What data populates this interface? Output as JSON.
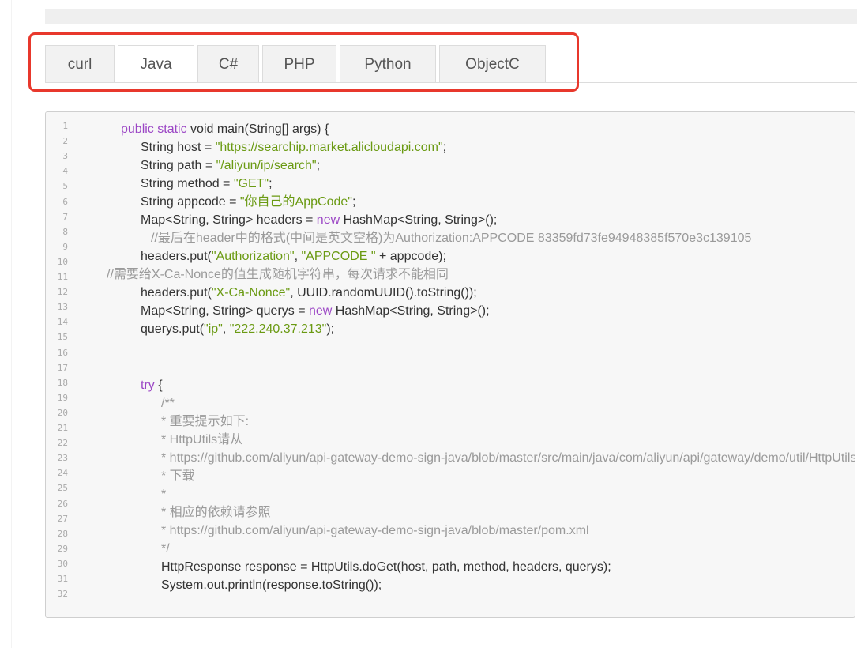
{
  "tabs": [
    {
      "label": "curl",
      "active": false
    },
    {
      "label": "Java",
      "active": true
    },
    {
      "label": "C#",
      "active": false
    },
    {
      "label": "PHP",
      "active": false
    },
    {
      "label": "Python",
      "active": false
    },
    {
      "label": "ObjectC",
      "active": false
    }
  ],
  "line_numbers": [
    "1",
    "2",
    "3",
    "4",
    "5",
    "6",
    "7",
    "8",
    "9",
    "10",
    "11",
    "12",
    "13",
    "14",
    "15",
    "16",
    "17",
    "18",
    "19",
    "20",
    "21",
    "22",
    "23",
    "24",
    "25",
    "26",
    "27",
    "28",
    "29",
    "30",
    "31",
    "32"
  ],
  "code_lines": [
    [
      {
        "t": "public static ",
        "c": "k"
      },
      {
        "t": "void main(String[] args) {",
        "c": "p"
      }
    ],
    [
      {
        "t": "String host = ",
        "c": "p"
      },
      {
        "t": "\"https://searchip.market.alicloudapi.com\"",
        "c": "s"
      },
      {
        "t": ";",
        "c": "p"
      }
    ],
    [
      {
        "t": "String path = ",
        "c": "p"
      },
      {
        "t": "\"/aliyun/ip/search\"",
        "c": "s"
      },
      {
        "t": ";",
        "c": "p"
      }
    ],
    [
      {
        "t": "String method = ",
        "c": "p"
      },
      {
        "t": "\"GET\"",
        "c": "s"
      },
      {
        "t": ";",
        "c": "p"
      }
    ],
    [
      {
        "t": "String appcode = ",
        "c": "p"
      },
      {
        "t": "\"你自己的AppCode\"",
        "c": "s"
      },
      {
        "t": ";",
        "c": "p"
      }
    ],
    [
      {
        "t": "Map<String, String> headers = ",
        "c": "p"
      },
      {
        "t": "new ",
        "c": "k"
      },
      {
        "t": "HashMap<String, String>();",
        "c": "p"
      }
    ],
    [
      {
        "t": "//最后在header中的格式(中间是英文空格)为Authorization:APPCODE 83359fd73fe94948385f570e3c139105",
        "c": "c"
      }
    ],
    [
      {
        "t": "headers.put(",
        "c": "p"
      },
      {
        "t": "\"Authorization\"",
        "c": "s"
      },
      {
        "t": ", ",
        "c": "p"
      },
      {
        "t": "\"APPCODE \"",
        "c": "s"
      },
      {
        "t": " + appcode);",
        "c": "p"
      }
    ],
    [
      {
        "t": "//需要给X-Ca-Nonce的值生成随机字符串，每次请求不能相同",
        "c": "c"
      }
    ],
    [
      {
        "t": "headers.put(",
        "c": "p"
      },
      {
        "t": "\"X-Ca-Nonce\"",
        "c": "s"
      },
      {
        "t": ", UUID.randomUUID().toString());",
        "c": "p"
      }
    ],
    [
      {
        "t": "Map<String, String> querys = ",
        "c": "p"
      },
      {
        "t": "new ",
        "c": "k"
      },
      {
        "t": "HashMap<String, String>();",
        "c": "p"
      }
    ],
    [
      {
        "t": "querys.put(",
        "c": "p"
      },
      {
        "t": "\"ip\"",
        "c": "s"
      },
      {
        "t": ", ",
        "c": "p"
      },
      {
        "t": "\"222.240.37.213\"",
        "c": "s"
      },
      {
        "t": ");",
        "c": "p"
      }
    ],
    [],
    [],
    [
      {
        "t": "try ",
        "c": "k"
      },
      {
        "t": "{",
        "c": "p"
      }
    ],
    [
      {
        "t": "/**",
        "c": "c"
      }
    ],
    [
      {
        "t": "* 重要提示如下:",
        "c": "c"
      }
    ],
    [
      {
        "t": "* HttpUtils请从",
        "c": "c"
      }
    ],
    [
      {
        "t": "* https://github.com/aliyun/api-gateway-demo-sign-java/blob/master/src/main/java/com/aliyun/api/gateway/demo/util/HttpUtils.java",
        "c": "c"
      }
    ],
    [
      {
        "t": "* 下载",
        "c": "c"
      }
    ],
    [
      {
        "t": "*",
        "c": "c"
      }
    ],
    [
      {
        "t": "* 相应的依赖请参照",
        "c": "c"
      }
    ],
    [
      {
        "t": "* https://github.com/aliyun/api-gateway-demo-sign-java/blob/master/pom.xml",
        "c": "c"
      }
    ],
    [
      {
        "t": "*/",
        "c": "c"
      }
    ],
    [
      {
        "t": "HttpResponse response = HttpUtils.doGet(host, path, method, headers, querys);",
        "c": "p"
      }
    ],
    [
      {
        "t": "System.out.println(response.toString());",
        "c": "p"
      }
    ]
  ]
}
